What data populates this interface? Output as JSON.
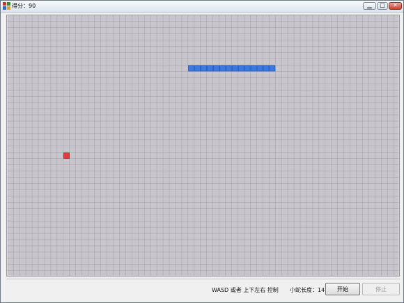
{
  "window": {
    "title": "得分：90"
  },
  "controls": {
    "minimize_icon": "minimize-icon",
    "maximize_icon": "maximize-icon",
    "close_icon": "close-icon"
  },
  "game": {
    "score": 90,
    "grid": {
      "cols": 63,
      "rows": 42
    },
    "snake": {
      "length": 14,
      "direction": "right",
      "body": [
        [
          29,
          8
        ],
        [
          30,
          8
        ],
        [
          31,
          8
        ],
        [
          32,
          8
        ],
        [
          33,
          8
        ],
        [
          34,
          8
        ],
        [
          35,
          8
        ],
        [
          36,
          8
        ],
        [
          37,
          8
        ],
        [
          38,
          8
        ],
        [
          39,
          8
        ],
        [
          40,
          8
        ],
        [
          41,
          8
        ],
        [
          42,
          8
        ]
      ]
    },
    "food": [
      9,
      22
    ],
    "colors": {
      "background": "#c8c5cc",
      "grid_line": "#9d9aa3",
      "snake": "#3a7ae0",
      "snake_border": "#1f56b7",
      "food": "#e23b3b",
      "food_border": "#b21f1f"
    }
  },
  "status": {
    "instructions": "WASD  或者  上下左右 控制",
    "snake_length_label": "小蛇长度：14"
  },
  "buttons": {
    "start": "开始",
    "stop": "停止"
  }
}
